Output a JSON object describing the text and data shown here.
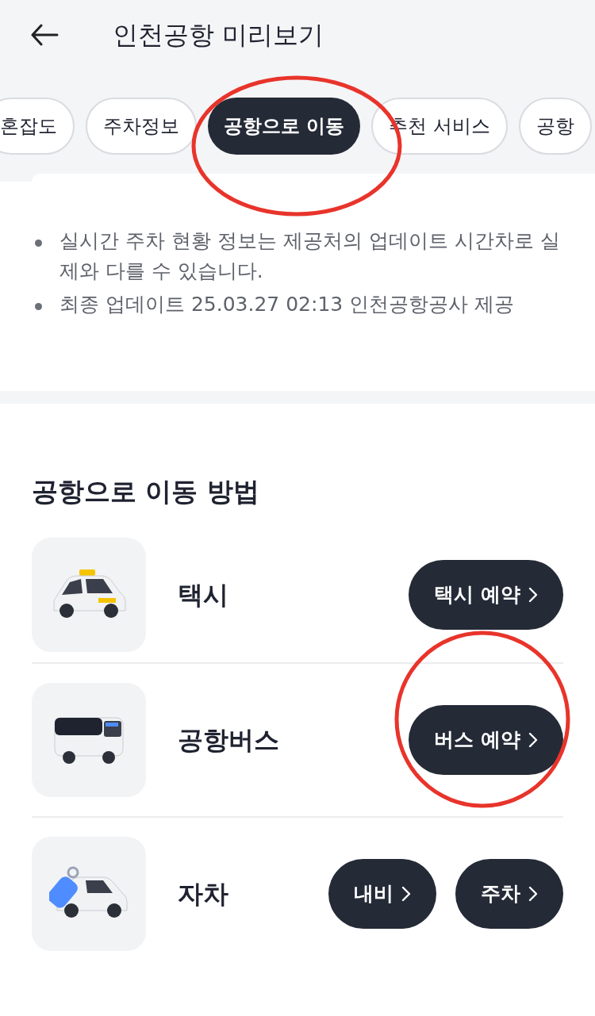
{
  "header": {
    "title": "인천공항 미리보기"
  },
  "tabs": [
    {
      "label": "혼잡도",
      "selected": false
    },
    {
      "label": "주차정보",
      "selected": false
    },
    {
      "label": "공항으로 이동",
      "selected": true
    },
    {
      "label": "추천 서비스",
      "selected": false
    },
    {
      "label": "공항",
      "selected": false
    }
  ],
  "notes": [
    "실시간 주차 현황 정보는 제공처의 업데이트 시간차로 실제와 다를 수 있습니다.",
    "최종 업데이트 25.03.27 02:13 인천공항공사 제공"
  ],
  "section": {
    "title": "공항으로 이동 방법",
    "methods": [
      {
        "kind": "taxi",
        "label": "택시",
        "buttons": [
          "택시 예약"
        ]
      },
      {
        "kind": "bus",
        "label": "공항버스",
        "buttons": [
          "버스 예약"
        ]
      },
      {
        "kind": "car",
        "label": "자차",
        "buttons": [
          "내비",
          "주차"
        ]
      }
    ]
  }
}
